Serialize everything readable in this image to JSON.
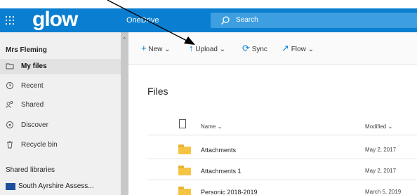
{
  "app": {
    "brand": "glow",
    "product": "OneDrive",
    "search_placeholder": "Search"
  },
  "sidebar": {
    "user_name": "Mrs Fleming",
    "items": [
      {
        "label": "My files",
        "icon": "folder-icon"
      },
      {
        "label": "Recent",
        "icon": "clock-icon"
      },
      {
        "label": "Shared",
        "icon": "people-icon"
      },
      {
        "label": "Discover",
        "icon": "discover-icon"
      },
      {
        "label": "Recycle bin",
        "icon": "recycle-bin-icon"
      }
    ],
    "section_title": "Shared libraries",
    "libraries": [
      {
        "label": "South Ayrshire Assess...",
        "icon": "school-logo-icon"
      }
    ]
  },
  "commandbar": {
    "new": "New",
    "upload": "Upload",
    "sync": "Sync",
    "flow": "Flow"
  },
  "main": {
    "title": "Files",
    "columns": {
      "name": "Name",
      "modified": "Modified"
    },
    "rows": [
      {
        "name": "Attachments",
        "modified": "May 2, 2017"
      },
      {
        "name": "Attachments 1",
        "modified": "May 2, 2017"
      },
      {
        "name": "Personic 2018-2019",
        "modified": "March 5, 2019"
      }
    ]
  },
  "colors": {
    "accent": "#0a7fd1",
    "folder": "#f6c443",
    "sidebar_bg": "#f0f0f0"
  }
}
